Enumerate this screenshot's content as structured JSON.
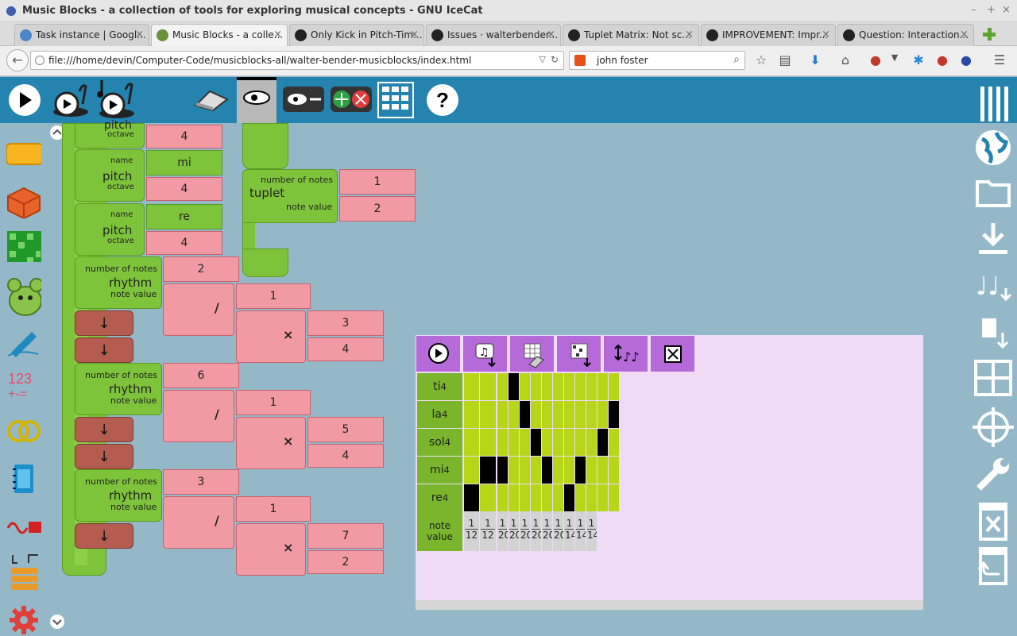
{
  "window": {
    "title": "Music Blocks - a collection of tools for exploring musical concepts - GNU IceCat",
    "controls": [
      "–",
      "+",
      "×"
    ]
  },
  "tabs": [
    {
      "label": "Task instance | Googl...",
      "color": "#4a86c8"
    },
    {
      "label": "Music Blocks - a colle...",
      "color": "#555"
    },
    {
      "label": "Only Kick in Pitch-Tim...",
      "color": "#222"
    },
    {
      "label": "Issues · walterbender...",
      "color": "#222"
    },
    {
      "label": "Tuplet Matrix: Not sc...",
      "color": "#222"
    },
    {
      "label": "IMPROVEMENT: Impr...",
      "color": "#222"
    },
    {
      "label": "Question: Interaction...",
      "color": "#222"
    }
  ],
  "tab_close": "×",
  "nav": {
    "url": "file:///home/devin/Computer-Code/musicblocks-all/walter-bender-musicblocks/index.html",
    "search": "john foster",
    "reload": "↻",
    "dropdown": "▽",
    "back": "←",
    "menu": "☰"
  },
  "blocks": {
    "pitch_top": {
      "title": "pitch",
      "octave_label": "octave",
      "octave": "4"
    },
    "pitch_mi": {
      "name_label": "name",
      "title": "pitch",
      "octave_label": "octave",
      "name": "mi",
      "octave": "4"
    },
    "pitch_re": {
      "name_label": "name",
      "title": "pitch",
      "octave_label": "octave",
      "name": "re",
      "octave": "4"
    },
    "rhythm1": {
      "notes_label": "number of notes",
      "title": "rhythm",
      "nv_label": "note value",
      "notes": "2",
      "num": "1",
      "mult_a": "3",
      "mult_b": "4"
    },
    "rhythm2": {
      "notes_label": "number of notes",
      "title": "rhythm",
      "nv_label": "note value",
      "notes": "6",
      "num": "1",
      "mult_a": "5",
      "mult_b": "4"
    },
    "rhythm3": {
      "notes_label": "number of notes",
      "title": "rhythm",
      "nv_label": "note value",
      "notes": "3",
      "num": "1",
      "mult_a": "7",
      "mult_b": "2"
    },
    "tuplet": {
      "notes_label": "number of notes",
      "title": "tuplet",
      "nv_label": "note value",
      "notes": "1",
      "value": "2"
    },
    "divide": "/",
    "multiply": "×",
    "down": "↓"
  },
  "matrix": {
    "rows": [
      {
        "note": "ti",
        "octave": "4",
        "cells": [
          0,
          0,
          0,
          1,
          0,
          0,
          0,
          0,
          0,
          0,
          0,
          0,
          0
        ]
      },
      {
        "note": "la",
        "octave": "4",
        "cells": [
          0,
          0,
          0,
          0,
          1,
          0,
          0,
          0,
          0,
          0,
          0,
          0,
          1
        ]
      },
      {
        "note": "sol",
        "octave": "4",
        "cells": [
          0,
          0,
          0,
          0,
          0,
          1,
          0,
          0,
          0,
          0,
          0,
          1,
          0
        ]
      },
      {
        "note": "mi",
        "octave": "4",
        "cells": [
          0,
          1,
          1,
          0,
          0,
          0,
          1,
          0,
          0,
          1,
          0,
          0,
          0
        ]
      },
      {
        "note": "re",
        "octave": "4",
        "cells": [
          1,
          0,
          0,
          0,
          0,
          0,
          0,
          0,
          1,
          0,
          0,
          0,
          0
        ]
      }
    ],
    "note_value_label": "note value",
    "note_values": [
      {
        "n": "1",
        "d": "12"
      },
      {
        "n": "1",
        "d": "12"
      },
      {
        "n": "1",
        "d": "20"
      },
      {
        "n": "1",
        "d": "20"
      },
      {
        "n": "1",
        "d": "20"
      },
      {
        "n": "1",
        "d": "20"
      },
      {
        "n": "1",
        "d": "20"
      },
      {
        "n": "1",
        "d": "20"
      },
      {
        "n": "1",
        "d": "14"
      },
      {
        "n": "1",
        "d": "14"
      },
      {
        "n": "1",
        "d": "14"
      }
    ],
    "toolbar_icons": [
      "play-icon",
      "save-notes-icon",
      "erase-matrix-icon",
      "export-matrix-icon",
      "sort-icon",
      "close-icon"
    ]
  },
  "colors": {
    "toolbar": "#2584af",
    "canvas": "#95b8c8",
    "green": "#7ec43a",
    "pink": "#f29aa3",
    "brown": "#b55c50",
    "matrix_bg": "#efdbf5",
    "matrix_btn": "#b66ad9",
    "cell": "#b6d617"
  }
}
